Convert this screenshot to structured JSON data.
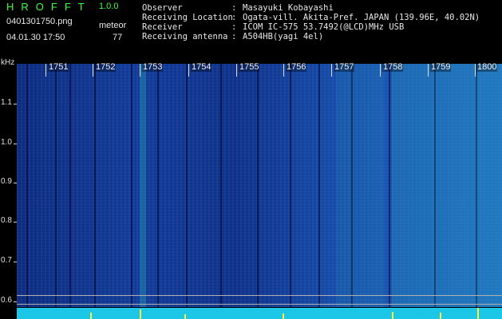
{
  "header": {
    "app_title": "HROFFT",
    "app_version": "1.0.0",
    "filename": "0401301750.png",
    "datetime": "04.01.30 17:50",
    "meteor_label": "meteor",
    "meteor_count": "77",
    "info": [
      {
        "label": "Observer",
        "value": "Masayuki Kobayashi"
      },
      {
        "label": "Receiving Location",
        "value": "Ogata-vill. Akita-Pref. JAPAN (139.96E, 40.02N)"
      },
      {
        "label": "Receiver",
        "value": "ICOM IC-575 53.7492(@LCD)MHz USB"
      },
      {
        "label": "Receiving antenna",
        "value": "A504HB(yagi 4el)"
      }
    ]
  },
  "spectrogram": {
    "y_unit": "kHz",
    "y_ticks": [
      "1.1",
      "1.0",
      "0.9",
      "0.8",
      "0.7",
      "0.6"
    ],
    "time_labels": [
      "1751",
      "1752",
      "1753",
      "1754",
      "1755",
      "1756",
      "1757",
      "1758",
      "1759",
      "1800"
    ],
    "colors": {
      "background": "#0f2f85",
      "signal": "#32c8be",
      "trace": "#1bc6e6",
      "spike": "#ffef3a",
      "title": "#3cff3c"
    }
  }
}
